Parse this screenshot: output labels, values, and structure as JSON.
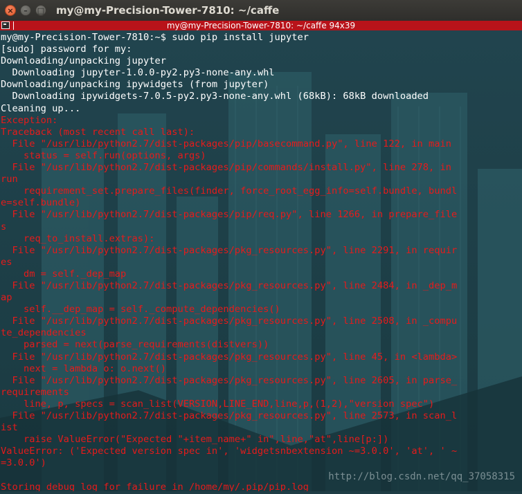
{
  "window": {
    "title": "my@my-Precision-Tower-7810: ~/caffe",
    "close_glyph": "×",
    "min_glyph": "–",
    "max_glyph": "□"
  },
  "terminal_header": {
    "title": "my@my-Precision-Tower-7810: ~/caffe 94x39"
  },
  "colors": {
    "normal_text": "#ffffff",
    "error_text": "#e61b1b",
    "header_bar": "#b8131a"
  },
  "terminal": {
    "lines": [
      {
        "text": "my@my-Precision-Tower-7810:~$ sudo pip install jupyter",
        "style": "white"
      },
      {
        "text": "[sudo] password for my:",
        "style": "white"
      },
      {
        "text": "Downloading/unpacking jupyter",
        "style": "white"
      },
      {
        "text": "  Downloading jupyter-1.0.0-py2.py3-none-any.whl",
        "style": "white"
      },
      {
        "text": "Downloading/unpacking ipywidgets (from jupyter)",
        "style": "white"
      },
      {
        "text": "  Downloading ipywidgets-7.0.5-py2.py3-none-any.whl (68kB): 68kB downloaded",
        "style": "white"
      },
      {
        "text": "Cleaning up...",
        "style": "white"
      },
      {
        "text": "Exception:",
        "style": "red"
      },
      {
        "text": "Traceback (most recent call last):",
        "style": "red"
      },
      {
        "text": "  File \"/usr/lib/python2.7/dist-packages/pip/basecommand.py\", line 122, in main",
        "style": "red"
      },
      {
        "text": "    status = self.run(options, args)",
        "style": "red"
      },
      {
        "text": "  File \"/usr/lib/python2.7/dist-packages/pip/commands/install.py\", line 278, in",
        "style": "red"
      },
      {
        "text": "run",
        "style": "red"
      },
      {
        "text": "    requirement_set.prepare_files(finder, force_root_egg_info=self.bundle, bundl",
        "style": "red"
      },
      {
        "text": "e=self.bundle)",
        "style": "red"
      },
      {
        "text": "  File \"/usr/lib/python2.7/dist-packages/pip/req.py\", line 1266, in prepare_file",
        "style": "red"
      },
      {
        "text": "s",
        "style": "red"
      },
      {
        "text": "    req_to_install.extras):",
        "style": "red"
      },
      {
        "text": "  File \"/usr/lib/python2.7/dist-packages/pkg_resources.py\", line 2291, in requir",
        "style": "red"
      },
      {
        "text": "es",
        "style": "red"
      },
      {
        "text": "    dm = self._dep_map",
        "style": "red"
      },
      {
        "text": "  File \"/usr/lib/python2.7/dist-packages/pkg_resources.py\", line 2484, in _dep_m",
        "style": "red"
      },
      {
        "text": "ap",
        "style": "red"
      },
      {
        "text": "    self.__dep_map = self._compute_dependencies()",
        "style": "red"
      },
      {
        "text": "  File \"/usr/lib/python2.7/dist-packages/pkg_resources.py\", line 2508, in _compu",
        "style": "red"
      },
      {
        "text": "te_dependencies",
        "style": "red"
      },
      {
        "text": "    parsed = next(parse_requirements(distvers))",
        "style": "red"
      },
      {
        "text": "  File \"/usr/lib/python2.7/dist-packages/pkg_resources.py\", line 45, in <lambda>",
        "style": "red"
      },
      {
        "text": "    next = lambda o: o.next()",
        "style": "red"
      },
      {
        "text": "  File \"/usr/lib/python2.7/dist-packages/pkg_resources.py\", line 2605, in parse_",
        "style": "red"
      },
      {
        "text": "requirements",
        "style": "red"
      },
      {
        "text": "    line, p, specs = scan_list(VERSION,LINE_END,line,p,(1,2),\"version spec\")",
        "style": "red"
      },
      {
        "text": "  File \"/usr/lib/python2.7/dist-packages/pkg_resources.py\", line 2573, in scan_l",
        "style": "red"
      },
      {
        "text": "ist",
        "style": "red"
      },
      {
        "text": "    raise ValueError(\"Expected \"+item_name+\" in\",line,\"at\",line[p:])",
        "style": "red"
      },
      {
        "text": "ValueError: ('Expected version spec in', 'widgetsnbextension ~=3.0.0', 'at', ' ~",
        "style": "red"
      },
      {
        "text": "=3.0.0')",
        "style": "red"
      },
      {
        "text": "",
        "style": "red"
      },
      {
        "text": "Storing debug log for failure in /home/my/.pip/pip.log",
        "style": "red"
      }
    ]
  },
  "watermark": {
    "text": "http://blog.csdn.net/qq_37058315"
  }
}
